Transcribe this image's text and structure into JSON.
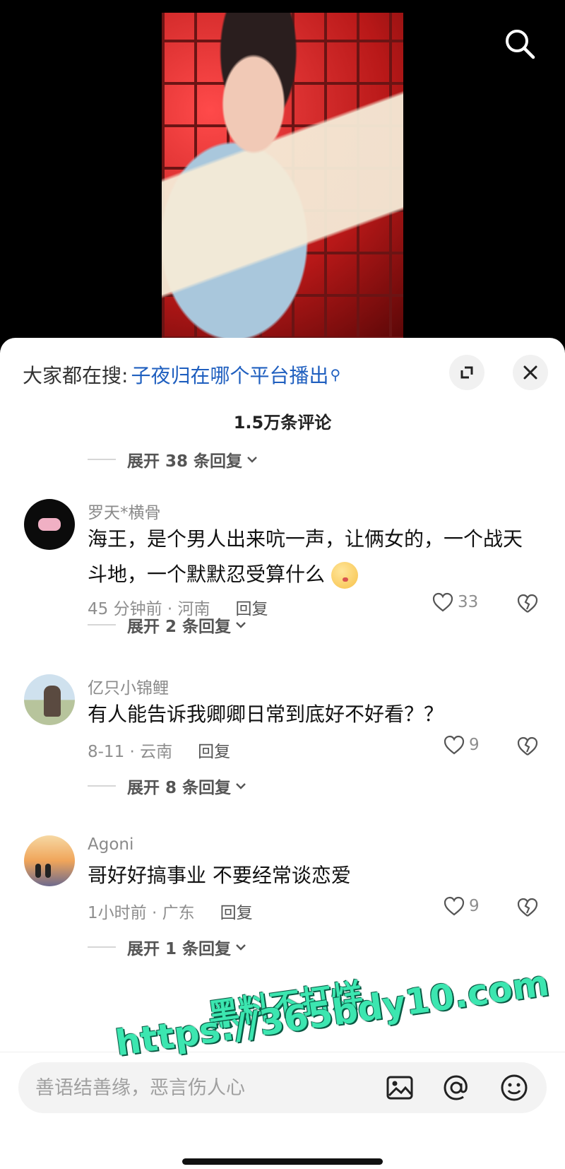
{
  "search_bar": {
    "prefix": "大家都在搜:",
    "query": "子夜归在哪个平台播出",
    "query_icon": "search-small-icon"
  },
  "header": {
    "comment_count": "1.5万条评论",
    "expand_icon": "expand-icon",
    "close_icon": "close-icon"
  },
  "top_replies_toggle": "展开 38 条回复",
  "comments": [
    {
      "username": "罗天*横骨",
      "text": "海王，是个男人出来吭一声，让俩女的，一个战天斗地，一个默默忍受算什么",
      "emoji": "blushing-emoji",
      "time_location": "45 分钟前 · 河南",
      "reply_label": "回复",
      "likes": "33",
      "replies_toggle": "展开 2 条回复"
    },
    {
      "username": "亿只小锦鲤",
      "text": "有人能告诉我卿卿日常到底好不好看？？",
      "time_location": "8-11 · 云南",
      "reply_label": "回复",
      "likes": "9",
      "replies_toggle": "展开 8 条回复"
    },
    {
      "username": "Agoni",
      "text": "哥好好搞事业 不要经常谈恋爱",
      "time_location": "1小时前 · 广东",
      "reply_label": "回复",
      "likes": "9",
      "replies_toggle": "展开 1 条回复"
    }
  ],
  "input": {
    "placeholder": "善语结善缘，恶言伤人心"
  },
  "watermark": {
    "line1": "黑料不打烊",
    "line2": "https://365bdy10.com"
  },
  "colors": {
    "link": "#1f5fbf",
    "watermark": "#3ce6b0"
  }
}
